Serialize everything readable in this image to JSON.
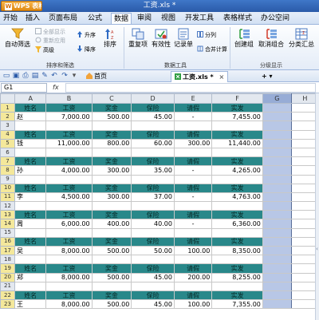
{
  "app": {
    "brand": "WPS 表格",
    "window_title": "工资.xls *"
  },
  "menu": [
    "开始",
    "插入",
    "页面布局",
    "公式",
    "数据",
    "审阅",
    "视图",
    "开发工具",
    "表格样式",
    "办公空间"
  ],
  "menu_active": "数据",
  "ribbon": {
    "auto_filter": "自动筛选",
    "show_all": "全部显示",
    "reapply": "重新应用",
    "advanced": "高级",
    "sort_asc": "升序",
    "sort_desc": "降序",
    "sort": "排序",
    "duplicates": "重复项",
    "validity": "有效性",
    "record_sheet": "记录单",
    "split": "分列",
    "consolidate": "合并计算",
    "group": "创建组",
    "ungroup": "取消组合",
    "subtotal": "分类汇总",
    "group_labels": [
      "排序和筛选",
      "数据工具",
      "分级显示"
    ]
  },
  "quickbar": {
    "tabs": [
      {
        "label": "首页",
        "active": false
      },
      {
        "label": "工资.xls *",
        "active": true
      }
    ],
    "add_label": "+"
  },
  "formula_bar": {
    "cell_ref": "G1",
    "fx_label": "fx",
    "value": ""
  },
  "sheet": {
    "columns": [
      "A",
      "B",
      "C",
      "D",
      "E",
      "F",
      "G",
      "H"
    ],
    "header_labels": [
      "姓名",
      "工资",
      "奖金",
      "保险",
      "请假",
      "实发"
    ],
    "rows": [
      {
        "n": "1",
        "type": "hdr"
      },
      {
        "n": "2",
        "type": "val",
        "cells": [
          "赵",
          "7,000.00",
          "500.00",
          "45.00",
          "-",
          "7,455.00"
        ]
      },
      {
        "n": "3",
        "type": "blank"
      },
      {
        "n": "4",
        "type": "hdr"
      },
      {
        "n": "5",
        "type": "val",
        "cells": [
          "钱",
          "11,000.00",
          "800.00",
          "60.00",
          "300.00",
          "11,440.00"
        ]
      },
      {
        "n": "6",
        "type": "blank"
      },
      {
        "n": "7",
        "type": "hdr"
      },
      {
        "n": "8",
        "type": "val",
        "cells": [
          "孙",
          "4,000.00",
          "300.00",
          "35.00",
          "-",
          "4,265.00"
        ]
      },
      {
        "n": "9",
        "type": "blank"
      },
      {
        "n": "10",
        "type": "hdr"
      },
      {
        "n": "11",
        "type": "val",
        "cells": [
          "李",
          "4,500.00",
          "300.00",
          "37.00",
          "-",
          "4,763.00"
        ]
      },
      {
        "n": "12",
        "type": "blank"
      },
      {
        "n": "13",
        "type": "hdr"
      },
      {
        "n": "14",
        "type": "val",
        "cells": [
          "周",
          "6,000.00",
          "400.00",
          "40.00",
          "-",
          "6,360.00"
        ]
      },
      {
        "n": "15",
        "type": "blank"
      },
      {
        "n": "16",
        "type": "hdr"
      },
      {
        "n": "17",
        "type": "val",
        "cells": [
          "吴",
          "8,000.00",
          "500.00",
          "50.00",
          "100.00",
          "8,350.00"
        ]
      },
      {
        "n": "18",
        "type": "blank"
      },
      {
        "n": "19",
        "type": "hdr"
      },
      {
        "n": "20",
        "type": "val",
        "cells": [
          "郑",
          "8,000.00",
          "500.00",
          "45.00",
          "200.00",
          "8,255.00"
        ]
      },
      {
        "n": "21",
        "type": "blank"
      },
      {
        "n": "22",
        "type": "hdr"
      },
      {
        "n": "23",
        "type": "val",
        "cells": [
          "王",
          "8,000.00",
          "500.00",
          "45.00",
          "100.00",
          "7,355.00"
        ]
      }
    ]
  },
  "colors": {
    "header_fill": "#29888a",
    "row_header_highlight": "#f4e89b",
    "selected_column": "#b8c7e6"
  }
}
